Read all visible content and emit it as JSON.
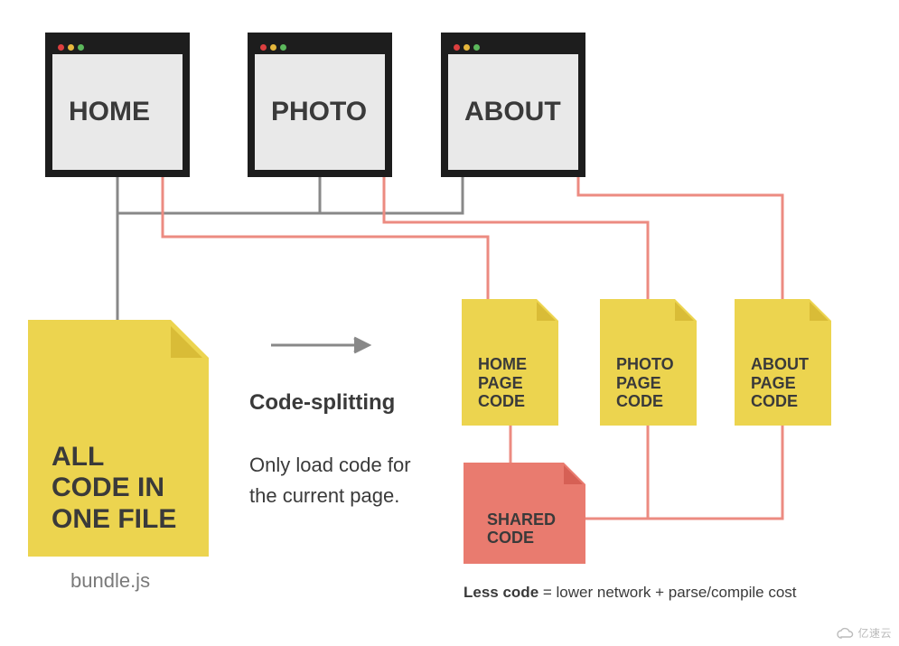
{
  "windows": {
    "home": {
      "label": "HOME"
    },
    "photo": {
      "label": "PHOTO"
    },
    "about": {
      "label": "ABOUT"
    }
  },
  "bundle": {
    "label": "ALL\nCODE IN\nONE FILE",
    "filename": "bundle.js"
  },
  "split_files": {
    "home": {
      "label": "HOME\nPAGE\nCODE"
    },
    "photo": {
      "label": "PHOTO\nPAGE\nCODE"
    },
    "about": {
      "label": "ABOUT\nPAGE\nCODE"
    },
    "shared": {
      "label": "SHARED\nCODE"
    }
  },
  "text": {
    "heading": "Code-splitting",
    "body": "Only load code for the current page.",
    "footnote_bold": "Less code",
    "footnote_rest": " = lower network + parse/compile cost"
  },
  "watermark": "亿速云"
}
